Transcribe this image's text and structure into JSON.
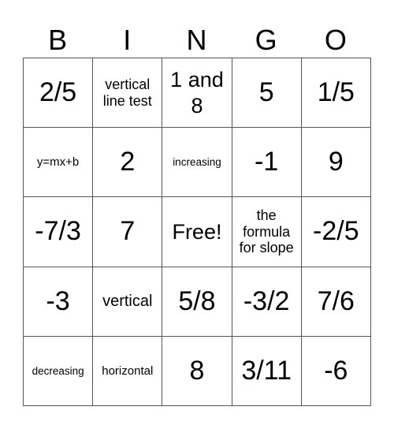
{
  "header": {
    "letters": [
      "B",
      "I",
      "N",
      "G",
      "O"
    ]
  },
  "grid": {
    "rows": [
      [
        "2/5",
        "vertical line test",
        "1 and 8",
        "5",
        "1/5"
      ],
      [
        "y=mx+b",
        "2",
        "increasing",
        "-1",
        "9"
      ],
      [
        "-7/3",
        "7",
        "Free!",
        "the formula for slope",
        "-2/5"
      ],
      [
        "-3",
        "vertical",
        "5/8",
        "-3/2",
        "7/6"
      ],
      [
        "decreasing",
        "horizontal",
        "8",
        "3/11",
        "-6"
      ]
    ]
  }
}
